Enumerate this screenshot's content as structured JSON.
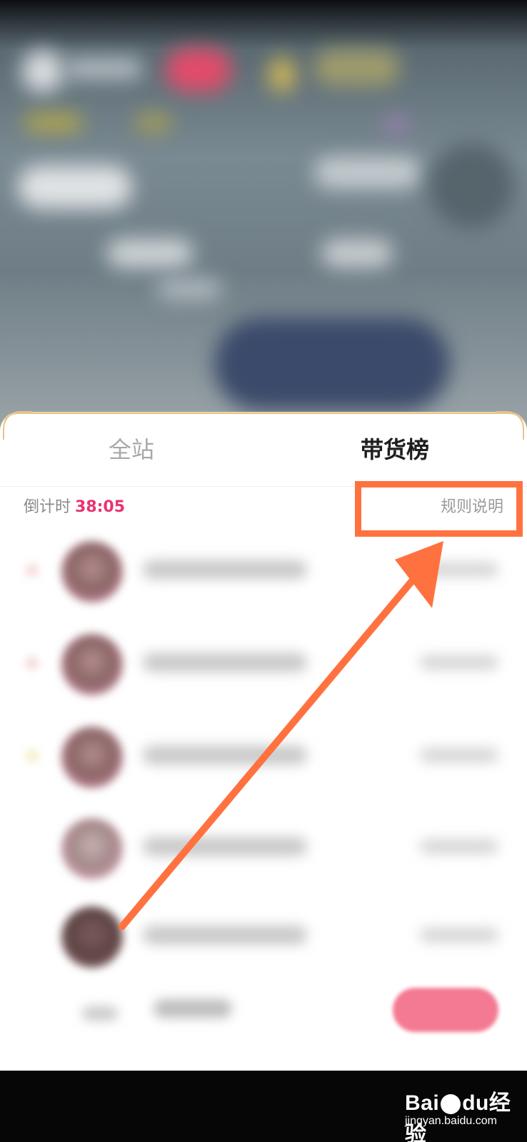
{
  "tabs": {
    "all": "全站",
    "goods": "带货榜"
  },
  "countdown": {
    "label": "倒计时",
    "time": "38:05"
  },
  "rules_link": "规则说明",
  "watermark": {
    "brand_left": "Bai",
    "brand_mid": "du",
    "brand_right": "经验",
    "url": "jingyan.baidu.com"
  },
  "colors": {
    "accent_countdown": "#e8336e",
    "annotation": "#ff7240",
    "sheet_border": "#e6c48a"
  },
  "icons": {
    "annotation_arrow": "arrow-icon",
    "watermark_paw": "paw-icon"
  }
}
